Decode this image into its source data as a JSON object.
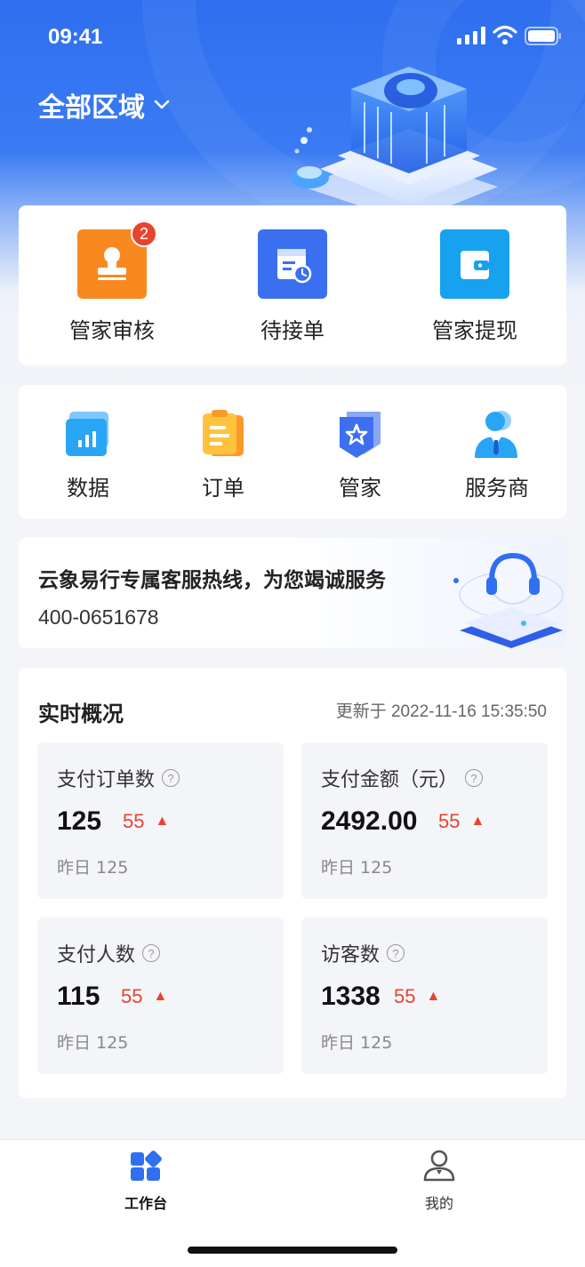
{
  "status_bar": {
    "time": "09:41"
  },
  "header": {
    "region_label": "全部区域"
  },
  "quick_actions": [
    {
      "label": "管家审核",
      "badge": "2",
      "color": "#f7891f"
    },
    {
      "label": "待接单",
      "color": "#3a6ff0"
    },
    {
      "label": "管家提现",
      "color": "#17a2ef"
    }
  ],
  "nav": [
    {
      "label": "数据"
    },
    {
      "label": "订单"
    },
    {
      "label": "管家"
    },
    {
      "label": "服务商"
    }
  ],
  "hotline": {
    "title": "云象易行专属客服热线，为您竭诚服务",
    "phone": "400-0651678"
  },
  "overview": {
    "title": "实时概况",
    "updated": "更新于 2022-11-16 15:35:50",
    "stats": [
      {
        "label": "支付订单数",
        "value": "125",
        "delta": "55",
        "yesterday": "昨日 125"
      },
      {
        "label": "支付金额（元）",
        "value": "2492.00",
        "delta": "55",
        "yesterday": "昨日 125"
      },
      {
        "label": "支付人数",
        "value": "115",
        "delta": "55",
        "yesterday": "昨日 125"
      },
      {
        "label": "访客数",
        "value": "1338",
        "delta": "55",
        "yesterday": "昨日 125"
      }
    ]
  },
  "tabbar": [
    {
      "label": "工作台",
      "active": true
    },
    {
      "label": "我的",
      "active": false
    }
  ],
  "colors": {
    "primary": "#2f6ff0",
    "alert": "#e8432e"
  }
}
